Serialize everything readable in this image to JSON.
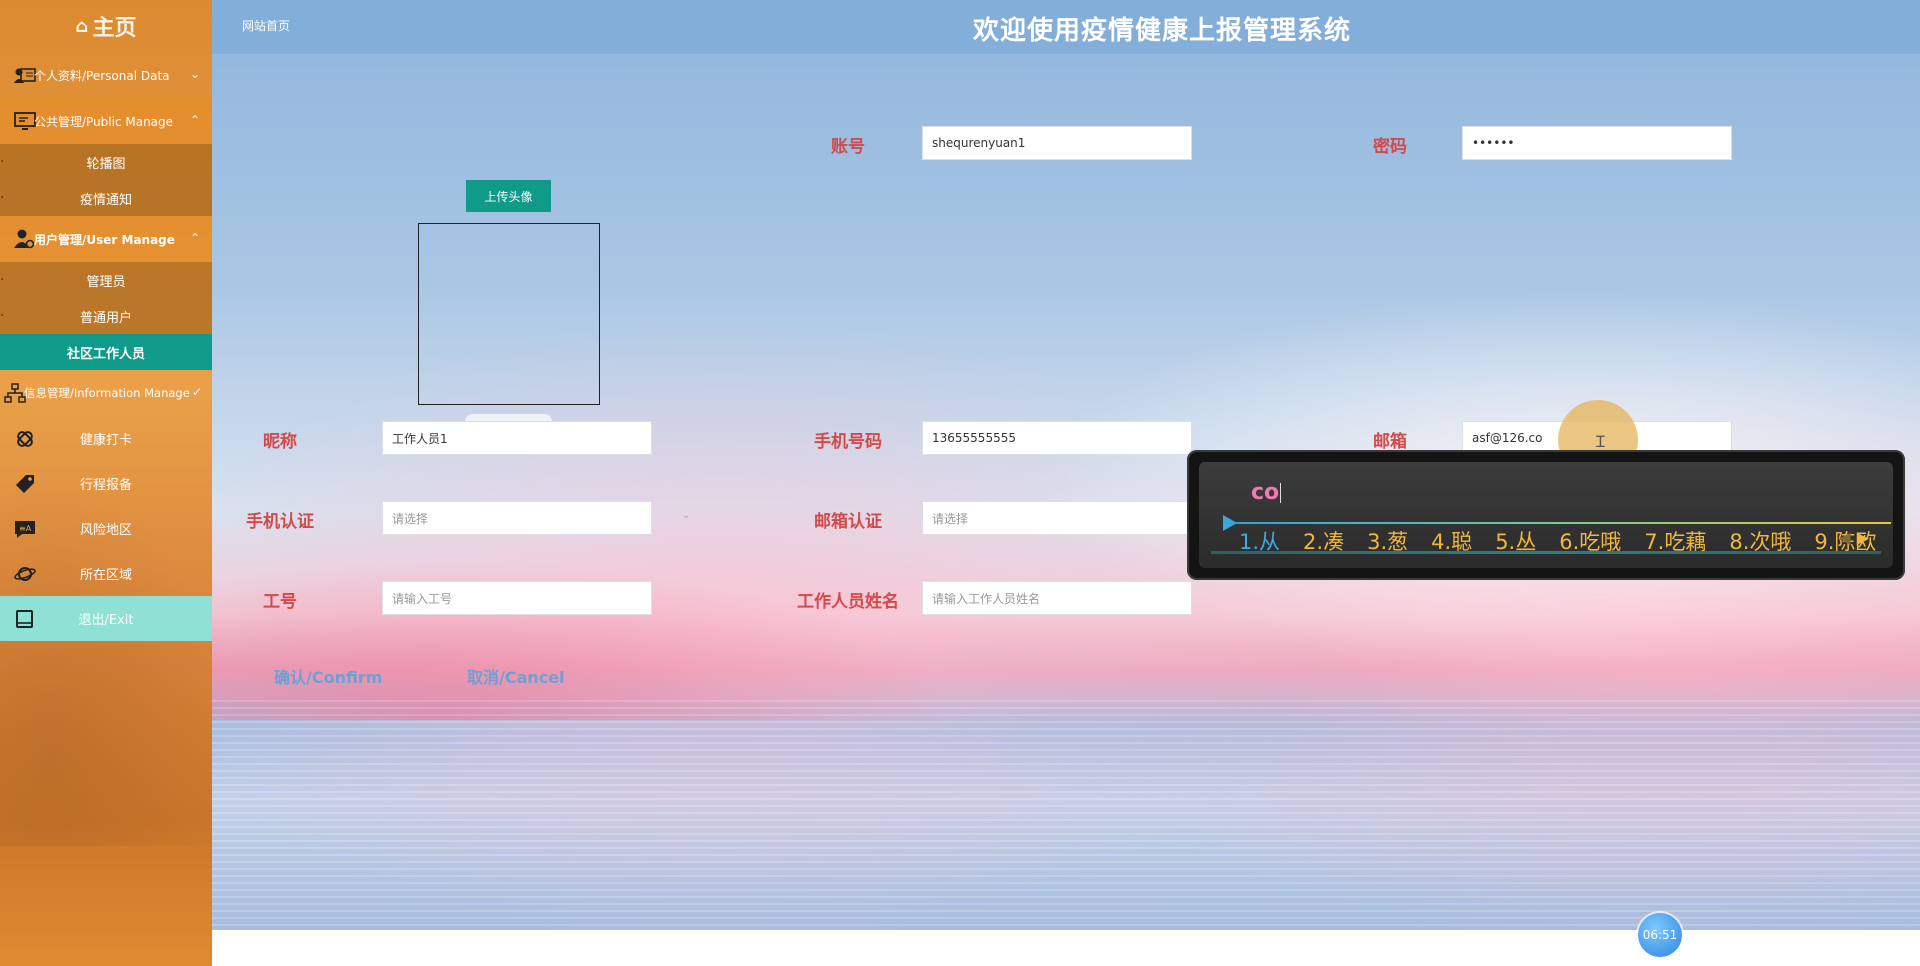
{
  "sidebar": {
    "home_label": "主页",
    "groups": [
      {
        "label": "个人资料/Personal Data",
        "icon": "person-card-icon",
        "expanded": false
      },
      {
        "label": "公共管理/Public Manage",
        "icon": "monitor-icon",
        "expanded": true,
        "items": [
          "轮播图",
          "疫情通知"
        ]
      },
      {
        "label": "用户管理/User Manage",
        "icon": "user-gear-icon",
        "expanded": true,
        "items": [
          "管理员",
          "普通用户",
          "社区工作人员"
        ],
        "active_item": "社区工作人员"
      },
      {
        "label": "信息管理/Information Manage",
        "icon": "org-chart-icon",
        "expanded": true
      }
    ],
    "info_items": [
      {
        "label": "健康打卡",
        "icon": "bandage-icon"
      },
      {
        "label": "行程报备",
        "icon": "tag-icon"
      },
      {
        "label": "风险地区",
        "icon": "chat-alert-icon"
      },
      {
        "label": "所在区域",
        "icon": "planet-icon"
      },
      {
        "label": "退出/Exit",
        "icon": "book-icon"
      }
    ]
  },
  "header": {
    "breadcrumb": "网站首页",
    "title": "欢迎使用疫情健康上报管理系统"
  },
  "form": {
    "upload_label": "上传头像",
    "account": {
      "label": "账号",
      "value": "shequrenyuan1"
    },
    "password": {
      "label": "密码",
      "value": "••••••"
    },
    "nickname": {
      "label": "昵称",
      "value": "工作人员1"
    },
    "phone": {
      "label": "手机号码",
      "value": "13655555555"
    },
    "email": {
      "label": "邮箱",
      "value": "asf@126.co"
    },
    "phone_verify": {
      "label": "手机认证",
      "placeholder": "请选择"
    },
    "email_verify": {
      "label": "邮箱认证",
      "placeholder": "请选择"
    },
    "job_no": {
      "label": "工号",
      "placeholder": "请输入工号"
    },
    "staff_name": {
      "label": "工作人员姓名",
      "placeholder": "请输入工作人员姓名"
    },
    "confirm_label": "确认/Confirm",
    "cancel_label": "取消/Cancel"
  },
  "ime": {
    "composition": "co",
    "candidates": [
      "1.从",
      "2.凑",
      "3.葱",
      "4.聪",
      "5.丛",
      "6.吃哦",
      "7.吃藕",
      "8.次哦",
      "9.陈欧"
    ]
  },
  "clock": "06:51"
}
